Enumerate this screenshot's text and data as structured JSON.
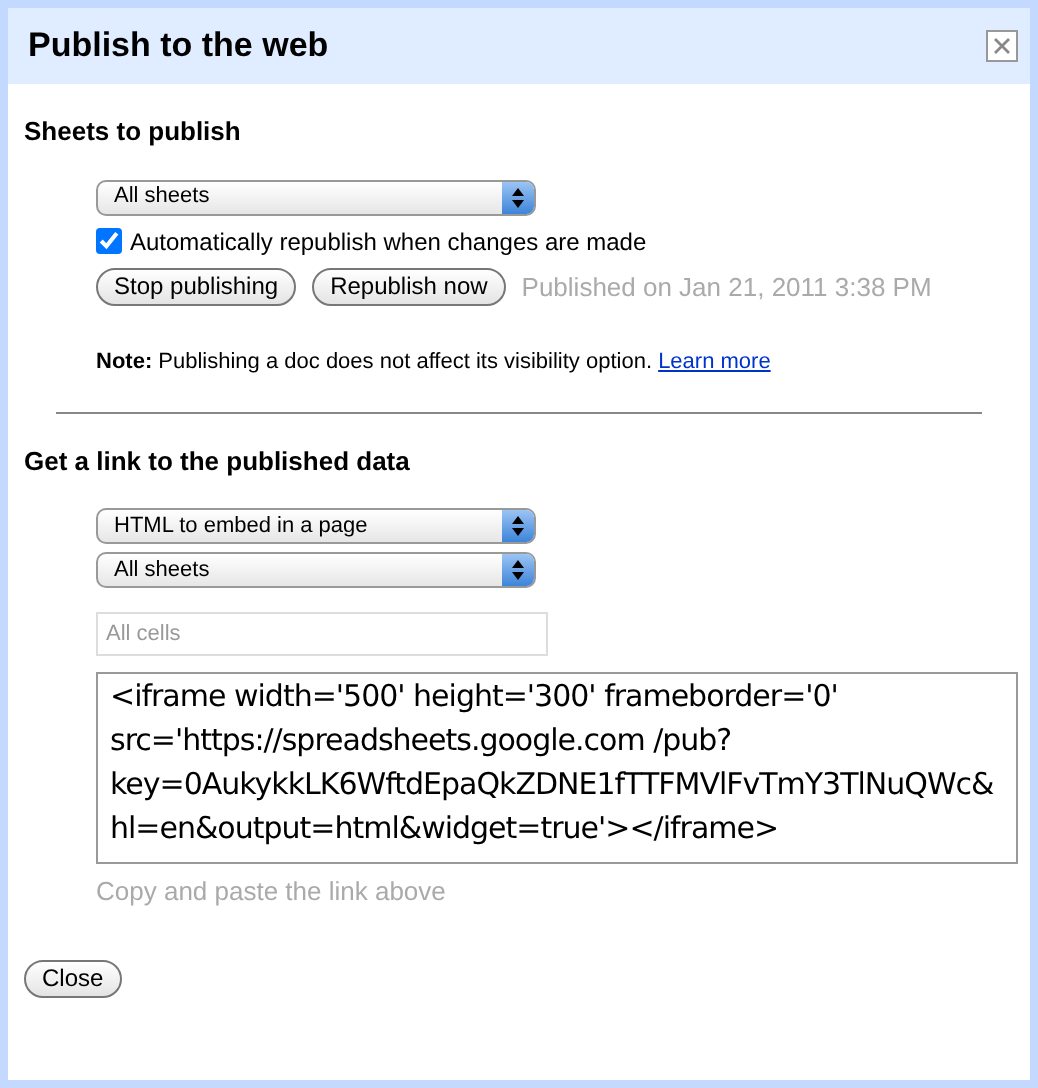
{
  "dialog": {
    "title": "Publish to the web"
  },
  "publish_section": {
    "heading": "Sheets to publish",
    "sheet_select": "All sheets",
    "auto_republish": {
      "label": "Automatically republish when changes are made",
      "checked": true
    },
    "buttons": [
      "Stop publishing",
      "Republish now"
    ],
    "status": "Published on Jan 21, 2011 3:38 PM",
    "note": "**Note:** Publishing a doc does not affect its visibility option.",
    "note_link": "Learn more"
  },
  "link_section": {
    "heading": "Get a link to the published data",
    "format_select": "HTML to embed in a page",
    "sheet_select": "All sheets",
    "range_field": {
      "placeholder": "All cells"
    },
    "code": "<iframe width='500' height='300' frameborder='0' src='https://spreadsheets.google.com /pub?key=0AukykkLK6WftdEpaQkZDNE1fTTFMVlFvTmY3TlNuQWc&hl=en&output=html&widget=true'></iframe>",
    "hint": "Copy and paste the link above"
  },
  "footer_buttons": [
    "Close"
  ]
}
